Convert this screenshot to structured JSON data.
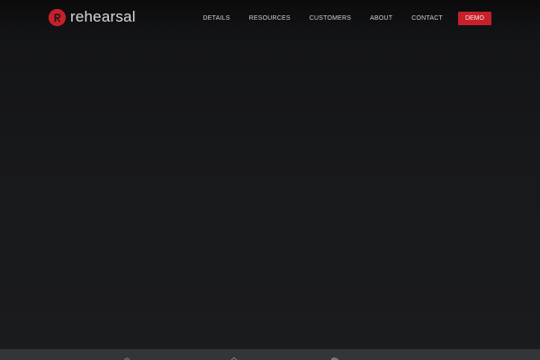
{
  "brand": {
    "name": "rehearsal",
    "logo_icon": "rehearsal-r-logo-icon",
    "accent": "#c8202b"
  },
  "nav": {
    "items": [
      {
        "label": "DETAILS"
      },
      {
        "label": "RESOURCES"
      },
      {
        "label": "CUSTOMERS"
      },
      {
        "label": "ABOUT"
      },
      {
        "label": "CONTACT"
      }
    ],
    "demo_label": "DEMO"
  },
  "colors": {
    "background_top": "#0b0b0c",
    "background_bottom": "#1a1b1d",
    "footer_strip": "#343538"
  }
}
